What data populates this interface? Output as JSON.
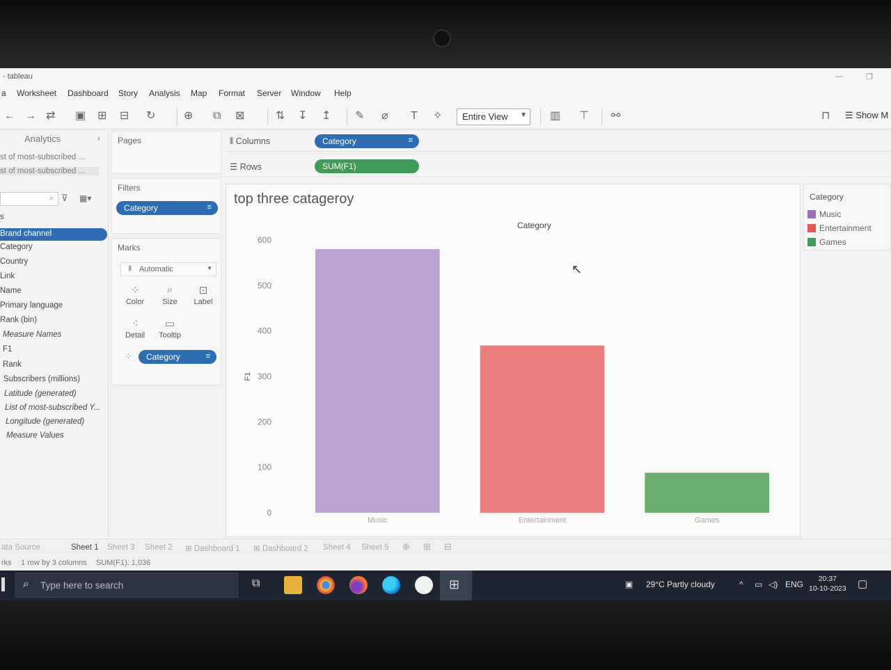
{
  "window": {
    "title": "- tableau"
  },
  "menu": [
    "a",
    "Worksheet",
    "Dashboard",
    "Story",
    "Analysis",
    "Map",
    "Format",
    "Server",
    "Window",
    "Help"
  ],
  "toolbar": {
    "view_select": "Entire View",
    "show_me": "Show M"
  },
  "data_panel": {
    "tab": "Analytics",
    "sources": [
      "st of most-subscribed ...",
      "st of most-subscribed ..."
    ],
    "section_letter": "s",
    "fields": [
      {
        "label": "Brand channel",
        "italic": false,
        "selected": true
      },
      {
        "label": "Category",
        "italic": false
      },
      {
        "label": "Country",
        "italic": false
      },
      {
        "label": "Link",
        "italic": false
      },
      {
        "label": "Name",
        "italic": false
      },
      {
        "label": "Primary language",
        "italic": false
      },
      {
        "label": "Rank (bin)",
        "italic": false
      },
      {
        "label": "Measure Names",
        "italic": true
      },
      {
        "label": "F1",
        "italic": false
      },
      {
        "label": "Rank",
        "italic": false
      },
      {
        "label": "Subscribers (millions)",
        "italic": false
      },
      {
        "label": "Latitude (generated)",
        "italic": true
      },
      {
        "label": "List of most-subscribed Y...",
        "italic": true
      },
      {
        "label": "Longitude (generated)",
        "italic": true
      },
      {
        "label": "Measure Values",
        "italic": true
      }
    ]
  },
  "cards": {
    "pages": "Pages",
    "filters": "Filters",
    "filter_pill": "Category",
    "marks": "Marks",
    "mark_type": "Automatic",
    "mark_buttons": [
      "Color",
      "Size",
      "Label",
      "Detail",
      "Tooltip"
    ],
    "color_pill": "Category"
  },
  "shelves": {
    "columns_label": "Columns",
    "columns_pill": "Category",
    "rows_label": "Rows",
    "rows_pill": "SUM(F1)"
  },
  "viz": {
    "title": "top three catageroy",
    "column_header": "Category"
  },
  "legend": {
    "title": "Category",
    "items": [
      {
        "label": "Music",
        "color": "#9b6fb5"
      },
      {
        "label": "Entertainment",
        "color": "#e05a5a"
      },
      {
        "label": "Games",
        "color": "#3f9b57"
      }
    ]
  },
  "chart_data": {
    "type": "bar",
    "categories": [
      "Music",
      "Entertainment",
      "Games"
    ],
    "values": [
      580,
      368,
      88
    ],
    "colors": [
      "#b9a3d6",
      "#ec7b7b",
      "#6cae6f"
    ],
    "ylabel": "F1",
    "xlabel": "",
    "ylim": [
      0,
      600
    ],
    "yticks": [
      0,
      100,
      200,
      300,
      400,
      500,
      600
    ]
  },
  "sheet_tabs": [
    {
      "label": "ata Source",
      "active": false
    },
    {
      "label": "Sheet 1",
      "active": true
    },
    {
      "label": "Sheet 3",
      "active": false
    },
    {
      "label": "Sheet 2",
      "active": false
    },
    {
      "label": "Dashboard 1",
      "active": false
    },
    {
      "label": "Dashboard 2",
      "active": false
    },
    {
      "label": "Sheet 4",
      "active": false
    },
    {
      "label": "Sheet 5",
      "active": false
    }
  ],
  "status": {
    "left": "rks",
    "rows": "1 row by 3 columns",
    "sum": "SUM(F1): 1,036"
  },
  "taskbar": {
    "search_placeholder": "Type here to search",
    "weather": "29°C  Partly cloudy",
    "lang": "ENG",
    "time": "20:37",
    "date": "10-10-2023"
  }
}
